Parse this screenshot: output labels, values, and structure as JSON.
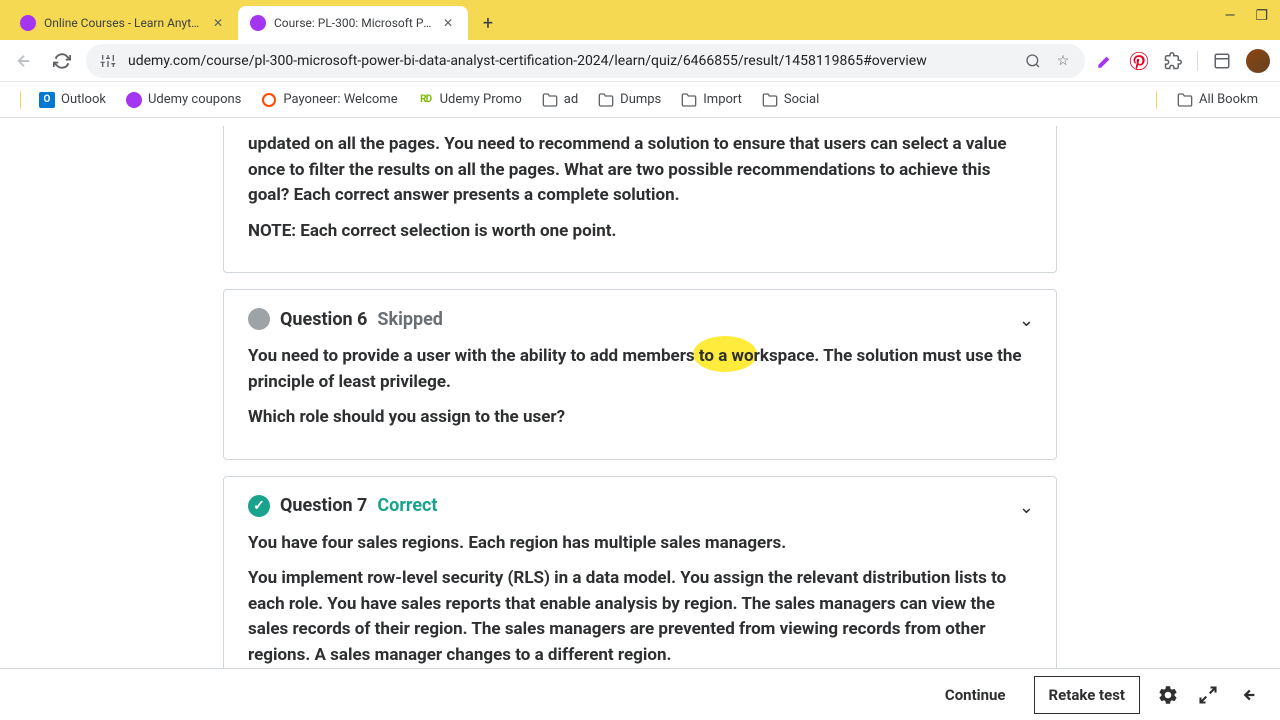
{
  "browser": {
    "tabs": [
      {
        "title": "Online Courses - Learn Anythin"
      },
      {
        "title": "Course: PL-300: Microsoft Powe"
      }
    ],
    "url": "udemy.com/course/pl-300-microsoft-power-bi-data-analyst-certification-2024/learn/quiz/6466855/result/1458119865#overview"
  },
  "bookmarks": {
    "items": [
      {
        "label": "Outlook"
      },
      {
        "label": "Udemy coupons"
      },
      {
        "label": "Payoneer: Welcome"
      },
      {
        "label": "Udemy Promo"
      },
      {
        "label": "ad"
      },
      {
        "label": "Dumps"
      },
      {
        "label": "Import"
      },
      {
        "label": "Social"
      }
    ],
    "all": "All Bookm"
  },
  "questions": {
    "q5": {
      "p1": "updated on all the pages. You need to recommend a solution to ensure that users can select a value once to filter the results on all the pages. What are two possible recommendations to achieve this goal? Each correct answer presents a complete solution.",
      "p2": "NOTE: Each correct selection is worth one point."
    },
    "q6": {
      "title": "Question 6",
      "status": "Skipped",
      "p1": "You need to provide a user with the ability to add members to a workspace. The solution must use the principle of least privilege.",
      "p2": "Which role should you assign to the user?"
    },
    "q7": {
      "title": "Question 7",
      "status": "Correct",
      "p1": "You have four sales regions. Each region has multiple sales managers.",
      "p2": "You implement row-level security (RLS) in a data model. You assign the relevant distribution lists to each role. You have sales reports that enable analysis by region. The sales managers can view the sales records of their region. The sales managers are prevented from viewing records from other regions. A sales manager changes to a different region."
    }
  },
  "footer": {
    "continue": "Continue",
    "retake": "Retake test"
  }
}
